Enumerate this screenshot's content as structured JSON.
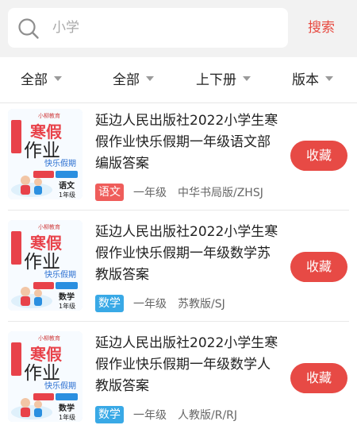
{
  "search": {
    "placeholder": "小学",
    "button_label": "搜索"
  },
  "filters": [
    {
      "label": "全部"
    },
    {
      "label": "全部"
    },
    {
      "label": "上下册"
    },
    {
      "label": "版本"
    }
  ],
  "colors": {
    "accent": "#e74a45",
    "yuwen": "#ef5d5b",
    "shuxue": "#39a9e6"
  },
  "books": [
    {
      "title": "延边人民出版社2022小学生寒假作业快乐假期一年级语文部编版答案",
      "subject": "语文",
      "subject_color": "#ef5d5b",
      "grade": "一年级",
      "publisher": "中华书局版/ZHSJ",
      "collect_label": "收藏",
      "cover": {
        "brand": "小柳教育",
        "t1": "寒假",
        "t2": "作业",
        "t3": "快乐假期",
        "subject": "语文",
        "grade": "1年级"
      }
    },
    {
      "title": "延边人民出版社2022小学生寒假作业快乐假期一年级数学苏教版答案",
      "subject": "数学",
      "subject_color": "#39a9e6",
      "grade": "一年级",
      "publisher": "苏教版/SJ",
      "collect_label": "收藏",
      "cover": {
        "brand": "小柳教育",
        "t1": "寒假",
        "t2": "作业",
        "t3": "快乐假期",
        "subject": "数学",
        "grade": "1年级"
      }
    },
    {
      "title": "延边人民出版社2022小学生寒假作业快乐假期一年级数学人教版答案",
      "subject": "数学",
      "subject_color": "#39a9e6",
      "grade": "一年级",
      "publisher": "人教版/R/RJ",
      "collect_label": "收藏",
      "cover": {
        "brand": "小柳教育",
        "t1": "寒假",
        "t2": "作业",
        "t3": "快乐假期",
        "subject": "数学",
        "grade": "1年级"
      }
    }
  ]
}
